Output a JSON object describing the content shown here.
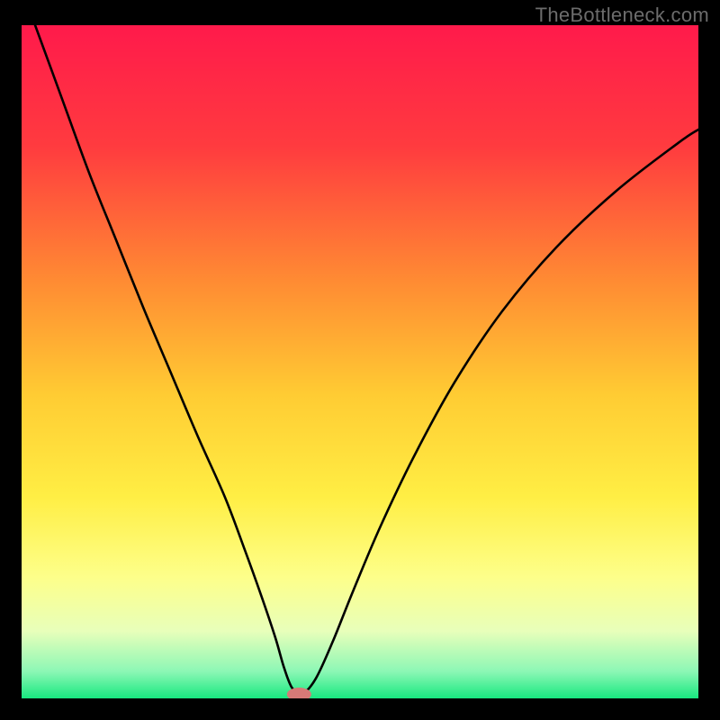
{
  "watermark": "TheBottleneck.com",
  "chart_data": {
    "type": "line",
    "title": "",
    "xlabel": "",
    "ylabel": "",
    "xlim": [
      0,
      100
    ],
    "ylim": [
      0,
      100
    ],
    "background_gradient": {
      "stops": [
        {
          "offset": 0,
          "color": "#ff1a4b"
        },
        {
          "offset": 18,
          "color": "#ff3b3f"
        },
        {
          "offset": 38,
          "color": "#ff8b33"
        },
        {
          "offset": 55,
          "color": "#ffcc33"
        },
        {
          "offset": 70,
          "color": "#ffee44"
        },
        {
          "offset": 82,
          "color": "#fdff8a"
        },
        {
          "offset": 90,
          "color": "#e8ffba"
        },
        {
          "offset": 96,
          "color": "#8cf7b5"
        },
        {
          "offset": 100,
          "color": "#18e880"
        }
      ]
    },
    "series": [
      {
        "name": "bottleneck-curve",
        "color": "#000000",
        "x": [
          2,
          6,
          10,
          14,
          18,
          22,
          26,
          30,
          33,
          35.5,
          37.5,
          38.8,
          40,
          41.5,
          43.5,
          46,
          49,
          53,
          58,
          64,
          71,
          79,
          88,
          97,
          100
        ],
        "y": [
          100,
          89,
          78,
          68,
          58,
          48.5,
          39,
          30,
          22,
          15,
          9,
          4.5,
          1.5,
          0.7,
          3,
          8.5,
          16,
          25.5,
          36,
          47,
          57.5,
          67,
          75.5,
          82.5,
          84.5
        ]
      }
    ],
    "marker": {
      "name": "optimal-point",
      "x": 41.0,
      "y": 0.6,
      "rx": 1.8,
      "ry": 1.0,
      "color": "#d77a77"
    }
  }
}
